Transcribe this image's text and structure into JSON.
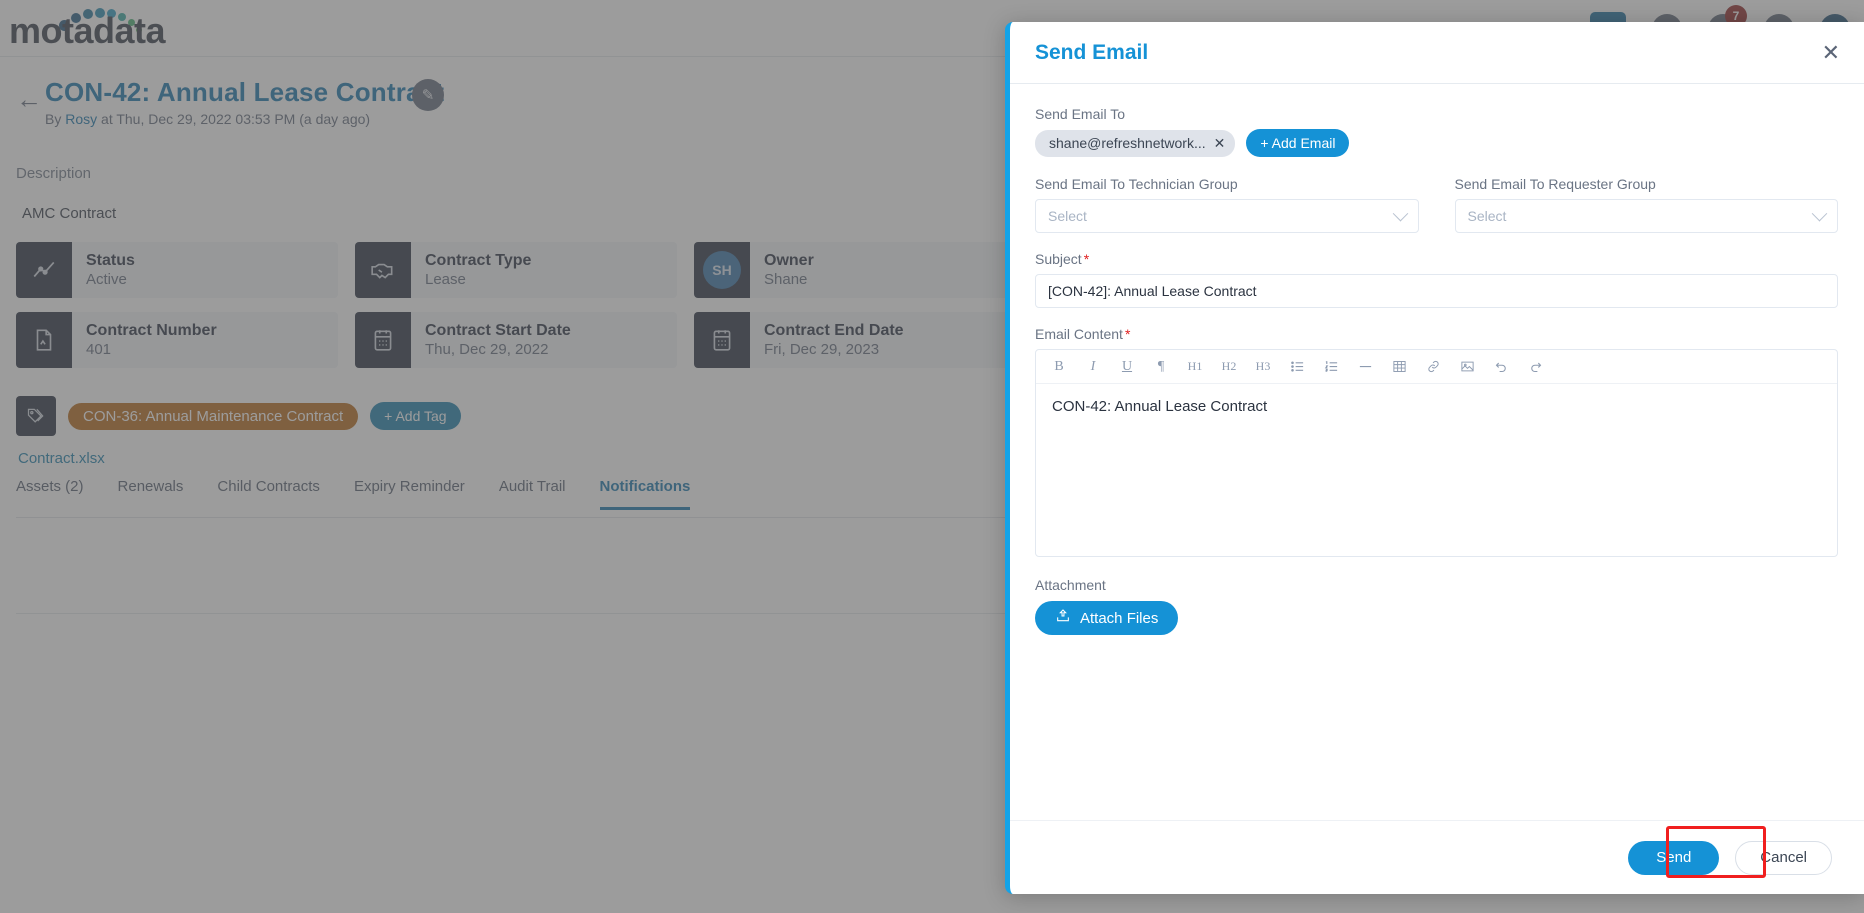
{
  "app": {
    "logo_text": "motadata",
    "notification_badge": "7"
  },
  "record": {
    "title": "CON-42: Annual Lease Contract",
    "meta_prefix": "By ",
    "meta_user": "Rosy",
    "meta_suffix": " at Thu, Dec 29, 2022 03:53 PM (a day ago)",
    "description_label": "Description",
    "description_value": "AMC Contract",
    "cards": [
      {
        "title": "Status",
        "value": "Active",
        "icon": "chart-line-icon"
      },
      {
        "title": "Contract Type",
        "value": "Lease",
        "icon": "handshake-icon"
      },
      {
        "title": "Owner",
        "value": "Shane",
        "icon": "avatar-icon",
        "initials": "SH"
      },
      {
        "title": "Contract Number",
        "value": "401",
        "icon": "document-icon"
      },
      {
        "title": "Contract Start Date",
        "value": "Thu, Dec 29, 2022",
        "icon": "calendar-icon"
      },
      {
        "title": "Contract End Date",
        "value": "Fri, Dec 29, 2023",
        "icon": "calendar-icon"
      }
    ],
    "tag": "CON-36: Annual Maintenance Contract",
    "add_tag_label": "+ Add Tag",
    "attachment_file": "Contract.xlsx",
    "tabs": [
      {
        "label": "Assets (2)",
        "active": false
      },
      {
        "label": "Renewals",
        "active": false
      },
      {
        "label": "Child Contracts",
        "active": false
      },
      {
        "label": "Expiry Reminder",
        "active": false
      },
      {
        "label": "Audit Trail",
        "active": false
      },
      {
        "label": "Notifications",
        "active": true
      }
    ]
  },
  "modal": {
    "title": "Send Email",
    "close_label": "✕",
    "send_email_to_label": "Send Email To",
    "recipient_chip": "shane@refreshnetwork...",
    "chip_remove": "✕",
    "add_email_label": "+ Add Email",
    "technician_group_label": "Send Email To Technician Group",
    "technician_group_value": "Select",
    "requester_group_label": "Send Email To Requester Group",
    "requester_group_value": "Select",
    "subject_label": "Subject",
    "subject_value": "[CON-42]: Annual Lease Contract",
    "email_content_label": "Email Content",
    "email_content_value": "CON-42: Annual Lease Contract",
    "required_mark": "*",
    "toolbar": [
      {
        "name": "bold-icon",
        "label": "B"
      },
      {
        "name": "italic-icon",
        "label": "I"
      },
      {
        "name": "underline-icon",
        "label": "U"
      },
      {
        "name": "paragraph-icon",
        "label": "¶"
      },
      {
        "name": "heading-1-icon",
        "label": "H1"
      },
      {
        "name": "heading-2-icon",
        "label": "H2"
      },
      {
        "name": "heading-3-icon",
        "label": "H3"
      },
      {
        "name": "bulleted-list-icon",
        "label": ""
      },
      {
        "name": "numbered-list-icon",
        "label": ""
      },
      {
        "name": "horizontal-rule-icon",
        "label": ""
      },
      {
        "name": "table-icon",
        "label": ""
      },
      {
        "name": "link-icon",
        "label": ""
      },
      {
        "name": "image-icon",
        "label": ""
      },
      {
        "name": "undo-icon",
        "label": ""
      },
      {
        "name": "redo-icon",
        "label": ""
      }
    ],
    "attachment_label": "Attachment",
    "attach_files_label": "Attach Files",
    "send_label": "Send",
    "cancel_label": "Cancel"
  },
  "colors": {
    "accent_blue": "#1592d6",
    "link_blue": "#0b6ea8",
    "tag_orange": "#b3620f",
    "dark_navy": "#1d2739",
    "highlight_red": "#f01f1f",
    "badge_red": "#8f1d1d"
  }
}
